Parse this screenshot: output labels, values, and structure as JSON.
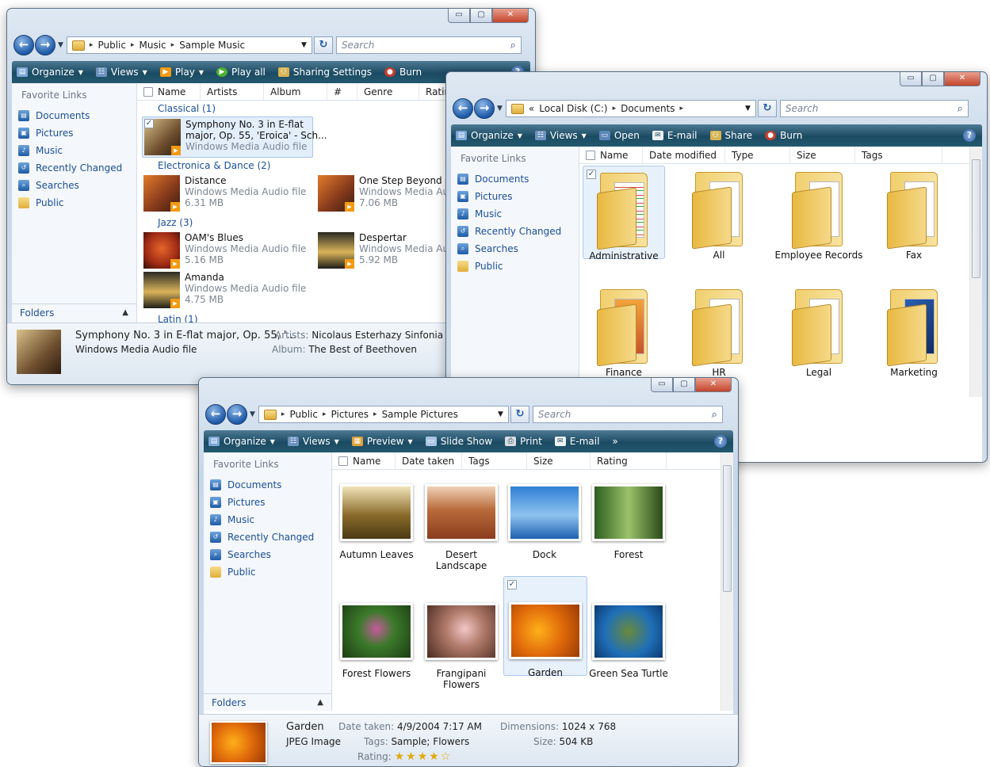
{
  "music_window": {
    "caption_buttons": [
      "▭",
      "▢",
      "✕"
    ],
    "breadcrumb": [
      "Public",
      "Music",
      "Sample Music"
    ],
    "search_placeholder": "Search",
    "toolbar": [
      "Organize",
      "Views",
      "Play",
      "Play all",
      "Sharing Settings",
      "Burn"
    ],
    "nav_header": "Favorite Links",
    "nav_items": [
      "Documents",
      "Pictures",
      "Music",
      "Recently Changed",
      "Searches",
      "Public"
    ],
    "folders_label": "Folders",
    "columns": [
      "Name",
      "Artists",
      "Album",
      "#",
      "Genre",
      "Ratin"
    ],
    "groups": [
      "Classical (1)",
      "Electronica & Dance (2)",
      "Jazz (3)",
      "Latin (1)"
    ],
    "tracks": [
      {
        "title": "Symphony No. 3 in E-flat",
        "title2": "major, Op. 55, 'Eroica' - Sch...",
        "type": "Windows Media Audio file"
      },
      {
        "title": "Distance",
        "type": "Windows Media Audio file",
        "size": "6.31 MB"
      },
      {
        "title": "One Step Beyond",
        "type": "Windows Media Aud",
        "size": "7.06 MB"
      },
      {
        "title": "OAM's Blues",
        "type": "Windows Media Audio file",
        "size": "5.16 MB"
      },
      {
        "title": "Despertar",
        "type": "Windows Media Aud",
        "size": "5.92 MB"
      },
      {
        "title": "Amanda",
        "type": "Windows Media Audio file",
        "size": "4.75 MB"
      }
    ],
    "details": {
      "title": "Symphony No. 3 in E-flat major, Op. 55, '...",
      "type": "Windows Media Audio file",
      "artists_label": "Artists:",
      "artists": "Nicolaus Esterhazy Sinfonia",
      "album_label": "Album:",
      "album": "The Best of Beethoven"
    }
  },
  "docs_window": {
    "caption_buttons": [
      "▭",
      "▢",
      "✕"
    ],
    "breadcrumb": [
      "«",
      "Local Disk (C:)",
      "Documents"
    ],
    "search_placeholder": "Search",
    "toolbar": [
      "Organize",
      "Views",
      "Open",
      "E-mail",
      "Share",
      "Burn"
    ],
    "nav_header": "Favorite Links",
    "nav_items": [
      "Documents",
      "Pictures",
      "Music",
      "Recently Changed",
      "Searches",
      "Public"
    ],
    "columns": [
      "Name",
      "Date modified",
      "Type",
      "Size",
      "Tags"
    ],
    "folders": [
      "Administrative",
      "All",
      "Employee Records",
      "Fax",
      "Finance",
      "HR",
      "Legal",
      "Marketing"
    ]
  },
  "pics_window": {
    "caption_buttons": [
      "▭",
      "▢",
      "✕"
    ],
    "breadcrumb": [
      "Public",
      "Pictures",
      "Sample Pictures"
    ],
    "search_placeholder": "Search",
    "toolbar": [
      "Organize",
      "Views",
      "Preview",
      "Slide Show",
      "Print",
      "E-mail",
      "»"
    ],
    "nav_header": "Favorite Links",
    "nav_items": [
      "Documents",
      "Pictures",
      "Music",
      "Recently Changed",
      "Searches",
      "Public"
    ],
    "folders_label": "Folders",
    "columns": [
      "Name",
      "Date taken",
      "Tags",
      "Size",
      "Rating"
    ],
    "photos": [
      "Autumn Leaves",
      "Desert Landscape",
      "Dock",
      "Forest",
      "Forest Flowers",
      "Frangipani Flowers",
      "Garden",
      "Green Sea Turtle"
    ],
    "details": {
      "name": "Garden",
      "type": "JPEG Image",
      "date_label": "Date taken:",
      "date": "4/9/2004 7:17 AM",
      "tags_label": "Tags:",
      "tags": "Sample; Flowers",
      "rating_label": "Rating:",
      "rating_stars": 4,
      "dim_label": "Dimensions:",
      "dim": "1024 x 768",
      "size_label": "Size:",
      "size": "504 KB"
    }
  },
  "colors": {
    "toolbar": "#1b4b63",
    "link": "#1b4e9b",
    "selection": "#e3eefb",
    "frame": "#c7d7e8"
  }
}
